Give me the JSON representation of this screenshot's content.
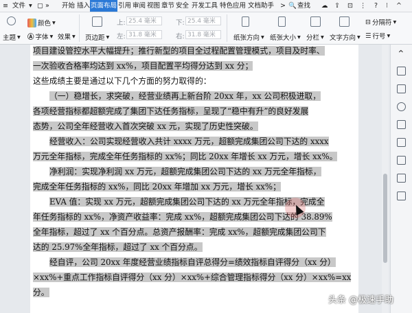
{
  "ribbon": {
    "tabs": [
      "文件",
      "开始",
      "插入",
      "页面布局",
      "引用",
      "审阅",
      "视图",
      "章节",
      "安全",
      "开发工具",
      "特色应用",
      "文档助手"
    ],
    "active_tab": "页面布局",
    "search_label": "查找",
    "tools": {
      "theme": "主题",
      "color": "颜色",
      "font": "字体",
      "effect": "效果",
      "page_margin": "页边距",
      "top_label": "上:",
      "top_value": "25.4 毫米",
      "bottom_label": "下:",
      "bottom_value": "25.4 毫米",
      "left_label": "左:",
      "left_value": "31.8 毫米",
      "right_label": "右:",
      "right_value": "31.8 毫米",
      "orientation": "纸张方向",
      "paper_size": "纸张大小",
      "columns": "分栏",
      "text_direction": "文字方向",
      "delimiter": "分隔符",
      "line_number": "行号"
    }
  },
  "document": {
    "lines": [
      {
        "text": "项目建设管控水平大幅提升；推行新型的项目全过程配置管理模式，项目及时率、",
        "selected": true,
        "indent": false
      },
      {
        "text": "一次验收合格率均达到 xx%，项目配置平均得分达到 xx 分；",
        "selected": true,
        "indent": false
      },
      {
        "text": "这些成绩主要是通过以下几个方面的努力取得的：",
        "selected": false,
        "indent": false
      },
      {
        "text": "（一）稳增长，求突破，经营业绩再上新台阶 20xx 年，xx 公司积极进取，",
        "selected": true,
        "indent": true
      },
      {
        "text": "各项经营指标都超额完成了集团下达任务指标，呈现了“稳中有升”的良好发展",
        "selected": true,
        "indent": false
      },
      {
        "text": "态势，公司全年经营收入首次突破 xx 元，实现了历史性突破。",
        "selected": true,
        "indent": false
      },
      {
        "text": "经营收入：公司实现经营收入共计 xxxx 万元，超额完成集团公司下达的 xxxx",
        "selected": true,
        "indent": true
      },
      {
        "text": "万元全年指标，完成全年任务指标的 xx%；同比 20xx 年增长 xx 万元，增长 xx%。",
        "selected": true,
        "indent": false
      },
      {
        "text": "净利润：实现净利润 xx 万元，超额完成集团公司下达的 xx 万元全年指标，",
        "selected": true,
        "indent": true
      },
      {
        "text": "完成全年任务指标的 xx%，同比 20xx 年增加 xx 万元，增长 xx%；",
        "selected": true,
        "indent": false
      },
      {
        "text": "EVA 值：实现 xx 万元，超额完成集团公司下达的 xx 万元全年指标，完成全",
        "selected": true,
        "indent": true
      },
      {
        "text": "年任务指标的 xx%，净资产收益率：完成 xx%，超额完成集团公司下达的 38.89%",
        "selected": true,
        "indent": false
      },
      {
        "text": "全年指标，超过了 xx 个百分点。总资产报酬率：完成 xx%，超额完成集团公司下",
        "selected": true,
        "indent": false
      },
      {
        "text": "达的 25.97%全年指标，超过了 xx 个百分点。",
        "selected": true,
        "indent": false
      },
      {
        "text": "经自评，公司 20xx 年度经营业绩指标自评总得分=绩效指标自评得分（xx 分）",
        "selected": true,
        "indent": true
      },
      {
        "text": "×xx%+重点工作指标自评得分（xx 分）×xx%+综合管理指标得分（xx 分）×xx%=xx",
        "selected": true,
        "indent": false
      },
      {
        "text": "分。",
        "selected": true,
        "indent": false
      }
    ]
  },
  "watermark": "头条 @极速手助"
}
